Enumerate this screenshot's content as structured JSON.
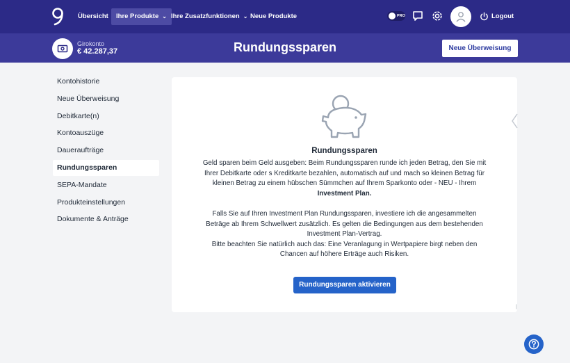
{
  "nav": {
    "items": [
      {
        "label": "Übersicht",
        "active": false
      },
      {
        "label": "Ihre Produkte",
        "active": true,
        "dropdown": true
      },
      {
        "label": "Ihre Zusatzfunktionen",
        "active": false,
        "dropdown": true
      },
      {
        "label": "Neue Produkte",
        "active": false
      }
    ],
    "pro_label": "PRO",
    "logout_label": "Logout",
    "icons": [
      "logo-icon",
      "pro-toggle",
      "chat-icon",
      "gear-icon",
      "user-icon",
      "power-icon"
    ]
  },
  "account": {
    "name": "Girokonto",
    "balance": "€ 42.287,37",
    "icon": "banknote-icon"
  },
  "page": {
    "title": "Rundungssparen",
    "transfer_button": "Neue Überweisung"
  },
  "sidebar": {
    "items": [
      {
        "label": "Kontohistorie",
        "active": false
      },
      {
        "label": "Neue Überweisung",
        "active": false
      },
      {
        "label": "Debitkarte(n)",
        "active": false
      },
      {
        "label": "Kontoauszüge",
        "active": false
      },
      {
        "label": "Daueraufträge",
        "active": false
      },
      {
        "label": "Rundungssparen",
        "active": true
      },
      {
        "label": "SEPA-Mandate",
        "active": false
      },
      {
        "label": "Produkteinstellungen",
        "active": false
      },
      {
        "label": "Dokumente & Anträge",
        "active": false
      }
    ]
  },
  "card": {
    "icon": "piggy-bank-icon",
    "title": "Rundungssparen",
    "para1_text": "Geld sparen beim Geld ausgeben: Beim Rundungssparen runde ich jeden Betrag, den Sie mit Ihrer Debitkarte oder s Kreditkarte bezahlen, automatisch auf und mach so kleinen Betrag für kleinen Betrag zu einem hübschen Sümmchen auf Ihrem Sparkonto oder - NEU - Ihrem ",
    "para1_bold": "Investment Plan.",
    "para2_line1": "Falls Sie auf Ihren Investment Plan Rundungssparen, investiere ich die angesammelten Beträge ab Ihrem Schwellwert zusätzlich. Es gelten die Bedingungen aus dem bestehenden Investment Plan-Vertrag.",
    "para2_line2": "Bitte beachten Sie natürlich auch das: Eine Veranlagung in Wertpapiere birgt neben den Chancen auf höhere Erträge auch Risiken.",
    "button": "Rundungssparen aktivieren"
  },
  "colors": {
    "nav_bg": "#2c2a87",
    "subheader_bg": "#3c3a9a",
    "accent_blue": "#2563c9",
    "page_bg": "#f3f4f6"
  }
}
